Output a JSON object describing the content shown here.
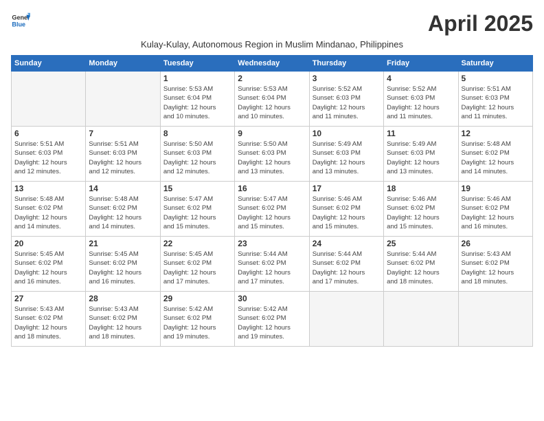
{
  "header": {
    "logo_line1": "General",
    "logo_line2": "Blue",
    "month_title": "April 2025",
    "subtitle": "Kulay-Kulay, Autonomous Region in Muslim Mindanao, Philippines"
  },
  "columns": [
    "Sunday",
    "Monday",
    "Tuesday",
    "Wednesday",
    "Thursday",
    "Friday",
    "Saturday"
  ],
  "weeks": [
    [
      {
        "day": "",
        "info": ""
      },
      {
        "day": "",
        "info": ""
      },
      {
        "day": "1",
        "info": "Sunrise: 5:53 AM\nSunset: 6:04 PM\nDaylight: 12 hours\nand 10 minutes."
      },
      {
        "day": "2",
        "info": "Sunrise: 5:53 AM\nSunset: 6:04 PM\nDaylight: 12 hours\nand 10 minutes."
      },
      {
        "day": "3",
        "info": "Sunrise: 5:52 AM\nSunset: 6:03 PM\nDaylight: 12 hours\nand 11 minutes."
      },
      {
        "day": "4",
        "info": "Sunrise: 5:52 AM\nSunset: 6:03 PM\nDaylight: 12 hours\nand 11 minutes."
      },
      {
        "day": "5",
        "info": "Sunrise: 5:51 AM\nSunset: 6:03 PM\nDaylight: 12 hours\nand 11 minutes."
      }
    ],
    [
      {
        "day": "6",
        "info": "Sunrise: 5:51 AM\nSunset: 6:03 PM\nDaylight: 12 hours\nand 12 minutes."
      },
      {
        "day": "7",
        "info": "Sunrise: 5:51 AM\nSunset: 6:03 PM\nDaylight: 12 hours\nand 12 minutes."
      },
      {
        "day": "8",
        "info": "Sunrise: 5:50 AM\nSunset: 6:03 PM\nDaylight: 12 hours\nand 12 minutes."
      },
      {
        "day": "9",
        "info": "Sunrise: 5:50 AM\nSunset: 6:03 PM\nDaylight: 12 hours\nand 13 minutes."
      },
      {
        "day": "10",
        "info": "Sunrise: 5:49 AM\nSunset: 6:03 PM\nDaylight: 12 hours\nand 13 minutes."
      },
      {
        "day": "11",
        "info": "Sunrise: 5:49 AM\nSunset: 6:03 PM\nDaylight: 12 hours\nand 13 minutes."
      },
      {
        "day": "12",
        "info": "Sunrise: 5:48 AM\nSunset: 6:02 PM\nDaylight: 12 hours\nand 14 minutes."
      }
    ],
    [
      {
        "day": "13",
        "info": "Sunrise: 5:48 AM\nSunset: 6:02 PM\nDaylight: 12 hours\nand 14 minutes."
      },
      {
        "day": "14",
        "info": "Sunrise: 5:48 AM\nSunset: 6:02 PM\nDaylight: 12 hours\nand 14 minutes."
      },
      {
        "day": "15",
        "info": "Sunrise: 5:47 AM\nSunset: 6:02 PM\nDaylight: 12 hours\nand 15 minutes."
      },
      {
        "day": "16",
        "info": "Sunrise: 5:47 AM\nSunset: 6:02 PM\nDaylight: 12 hours\nand 15 minutes."
      },
      {
        "day": "17",
        "info": "Sunrise: 5:46 AM\nSunset: 6:02 PM\nDaylight: 12 hours\nand 15 minutes."
      },
      {
        "day": "18",
        "info": "Sunrise: 5:46 AM\nSunset: 6:02 PM\nDaylight: 12 hours\nand 15 minutes."
      },
      {
        "day": "19",
        "info": "Sunrise: 5:46 AM\nSunset: 6:02 PM\nDaylight: 12 hours\nand 16 minutes."
      }
    ],
    [
      {
        "day": "20",
        "info": "Sunrise: 5:45 AM\nSunset: 6:02 PM\nDaylight: 12 hours\nand 16 minutes."
      },
      {
        "day": "21",
        "info": "Sunrise: 5:45 AM\nSunset: 6:02 PM\nDaylight: 12 hours\nand 16 minutes."
      },
      {
        "day": "22",
        "info": "Sunrise: 5:45 AM\nSunset: 6:02 PM\nDaylight: 12 hours\nand 17 minutes."
      },
      {
        "day": "23",
        "info": "Sunrise: 5:44 AM\nSunset: 6:02 PM\nDaylight: 12 hours\nand 17 minutes."
      },
      {
        "day": "24",
        "info": "Sunrise: 5:44 AM\nSunset: 6:02 PM\nDaylight: 12 hours\nand 17 minutes."
      },
      {
        "day": "25",
        "info": "Sunrise: 5:44 AM\nSunset: 6:02 PM\nDaylight: 12 hours\nand 18 minutes."
      },
      {
        "day": "26",
        "info": "Sunrise: 5:43 AM\nSunset: 6:02 PM\nDaylight: 12 hours\nand 18 minutes."
      }
    ],
    [
      {
        "day": "27",
        "info": "Sunrise: 5:43 AM\nSunset: 6:02 PM\nDaylight: 12 hours\nand 18 minutes."
      },
      {
        "day": "28",
        "info": "Sunrise: 5:43 AM\nSunset: 6:02 PM\nDaylight: 12 hours\nand 18 minutes."
      },
      {
        "day": "29",
        "info": "Sunrise: 5:42 AM\nSunset: 6:02 PM\nDaylight: 12 hours\nand 19 minutes."
      },
      {
        "day": "30",
        "info": "Sunrise: 5:42 AM\nSunset: 6:02 PM\nDaylight: 12 hours\nand 19 minutes."
      },
      {
        "day": "",
        "info": ""
      },
      {
        "day": "",
        "info": ""
      },
      {
        "day": "",
        "info": ""
      }
    ]
  ]
}
